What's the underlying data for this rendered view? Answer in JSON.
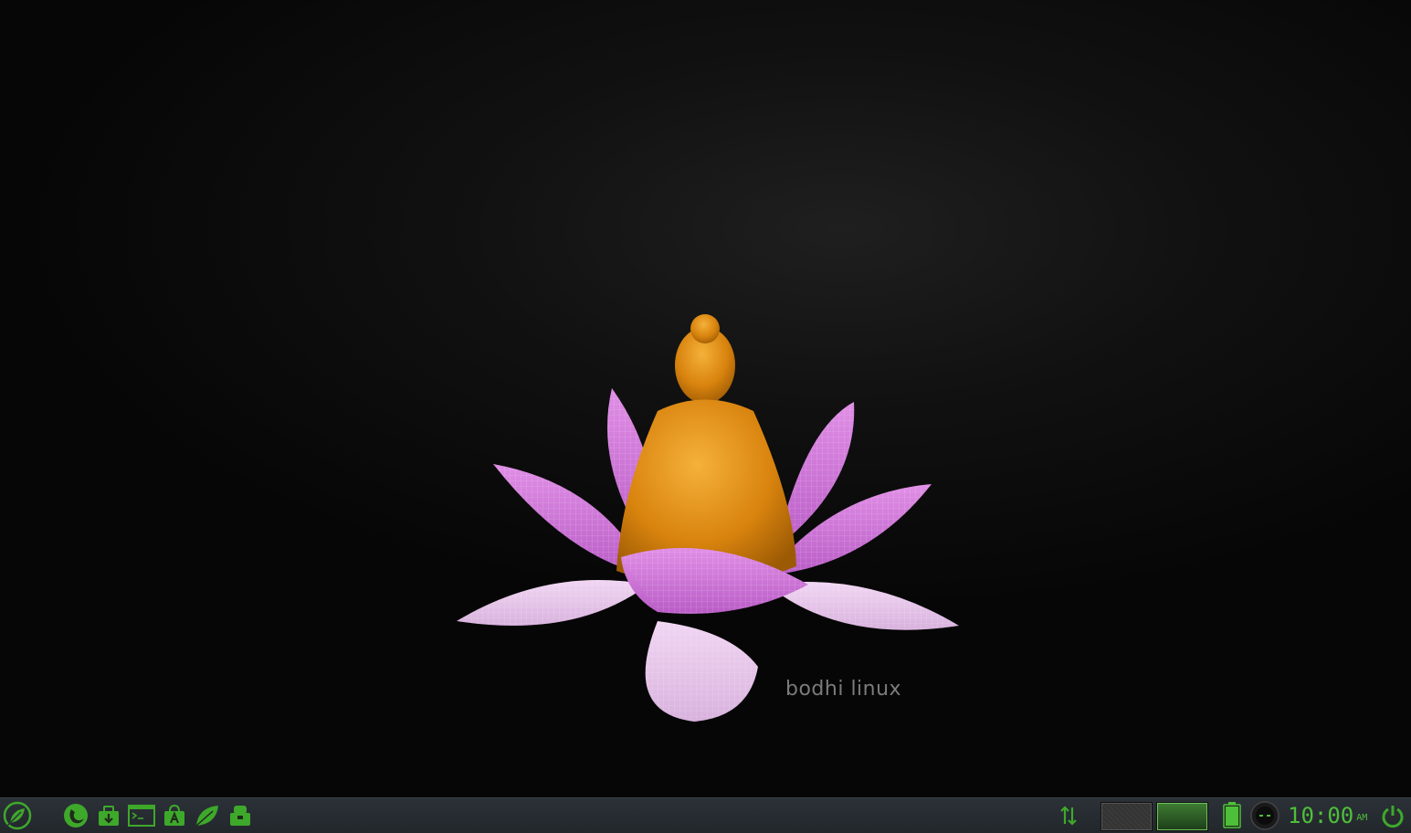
{
  "desktop": {
    "wallpaper": {
      "brand_text": "bodhi linux"
    }
  },
  "taskbar": {
    "launchers": [
      {
        "icon": "bodhi-leaf-menu-icon"
      },
      {
        "icon": "firefox-icon"
      },
      {
        "icon": "app-center-icon"
      },
      {
        "icon": "terminal-icon"
      },
      {
        "icon": "software-store-icon"
      },
      {
        "icon": "bodhi-leaf-icon"
      },
      {
        "icon": "package-installer-icon"
      }
    ],
    "tray": {
      "network_icon": "network-arrows-icon",
      "pager": {
        "desktops": 2,
        "active": 2
      },
      "battery_icon": "battery-icon",
      "mixer_icon": "volume-mixer-icon",
      "clock_time": "10:00",
      "clock_ampm": "AM",
      "power_icon": "power-icon"
    },
    "colors": {
      "accent": "#4fbf3a",
      "bar": "#252a30"
    }
  }
}
